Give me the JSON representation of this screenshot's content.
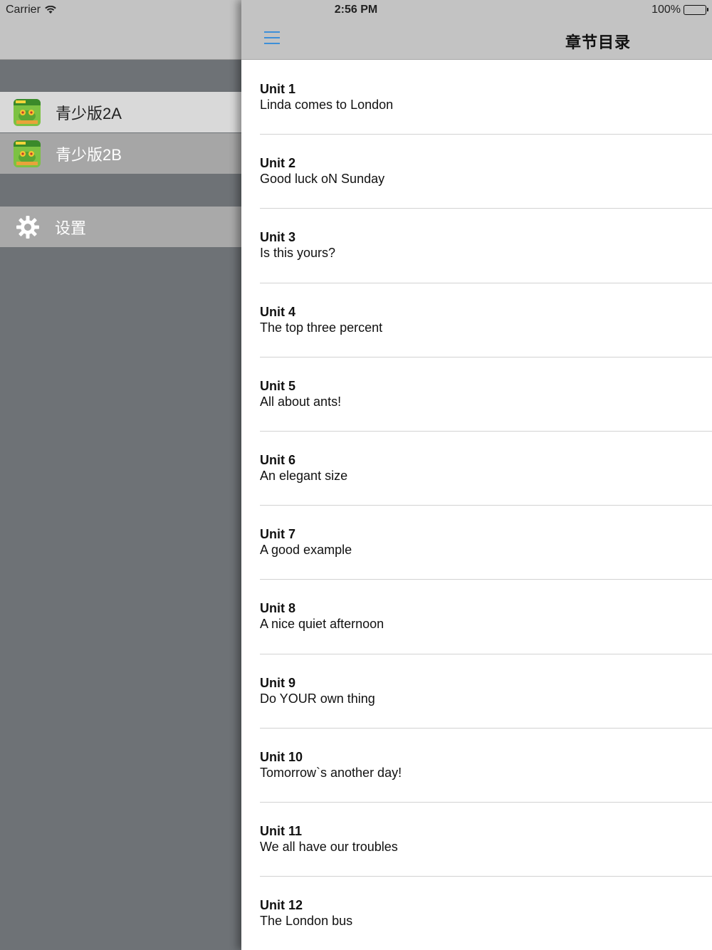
{
  "status_bar": {
    "carrier": "Carrier",
    "time": "2:56 PM",
    "battery": "100%"
  },
  "sidebar": {
    "books": [
      {
        "label": "青少版2A",
        "icon": "book-cover-icon"
      },
      {
        "label": "青少版2B",
        "icon": "book-cover-icon"
      }
    ],
    "settings_label": "设置"
  },
  "nav": {
    "title": "章节目录"
  },
  "units": [
    {
      "title": "Unit 1",
      "subtitle": "Linda comes to London"
    },
    {
      "title": "Unit 2",
      "subtitle": "Good luck oN Sunday"
    },
    {
      "title": "Unit 3",
      "subtitle": "Is this yours?"
    },
    {
      "title": "Unit 4",
      "subtitle": "The top three percent"
    },
    {
      "title": "Unit 5",
      "subtitle": "All about ants!"
    },
    {
      "title": "Unit 6",
      "subtitle": "An elegant size"
    },
    {
      "title": "Unit 7",
      "subtitle": "A good example"
    },
    {
      "title": "Unit 8",
      "subtitle": "A nice quiet afternoon"
    },
    {
      "title": "Unit 9",
      "subtitle": "Do YOUR own thing"
    },
    {
      "title": "Unit 10",
      "subtitle": "Tomorrow`s another day!"
    },
    {
      "title": "Unit 11",
      "subtitle": "We all have our troubles"
    },
    {
      "title": "Unit 12",
      "subtitle": "The London bus"
    }
  ],
  "colors": {
    "accent": "#3d8fd8",
    "sidebar_bg": "#6e7276",
    "navbar_bg": "#c3c3c3"
  }
}
